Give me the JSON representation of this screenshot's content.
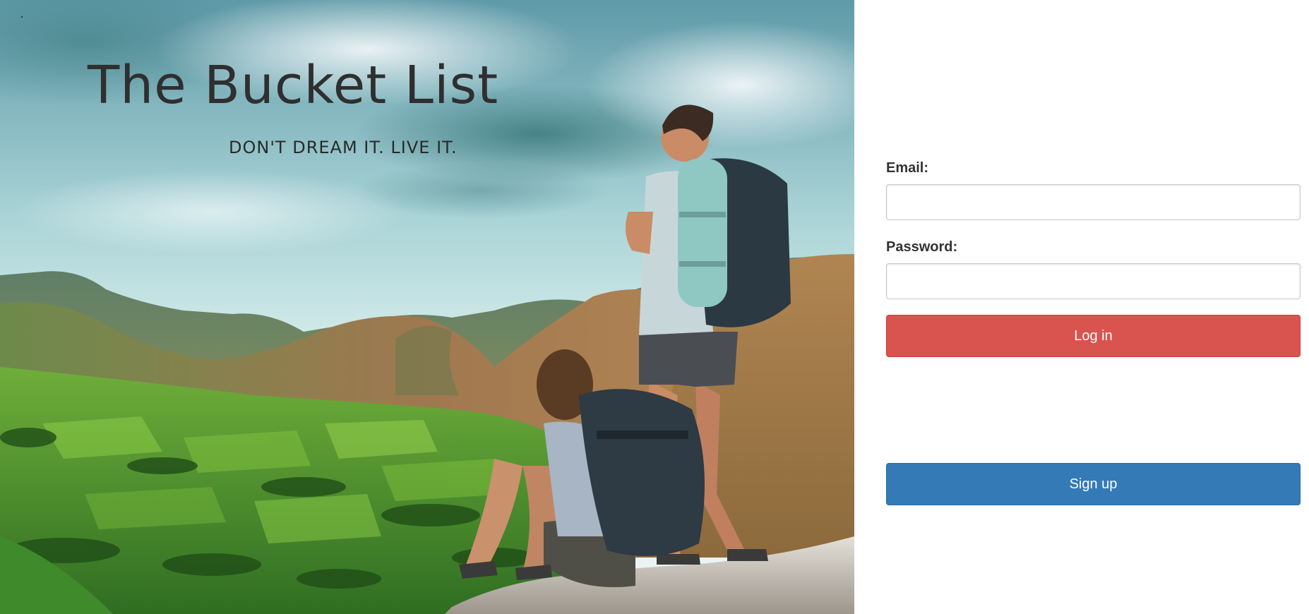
{
  "hero": {
    "title": "The Bucket List",
    "tagline": "DON'T DREAM IT. LIVE IT."
  },
  "login_form": {
    "email_label": "Email:",
    "email_value": "",
    "password_label": "Password:",
    "password_value": "",
    "login_button": "Log in",
    "signup_button": "Sign up"
  },
  "colors": {
    "login_button": "#d9534f",
    "signup_button": "#337ab7",
    "title_text": "#2f2f2f"
  }
}
